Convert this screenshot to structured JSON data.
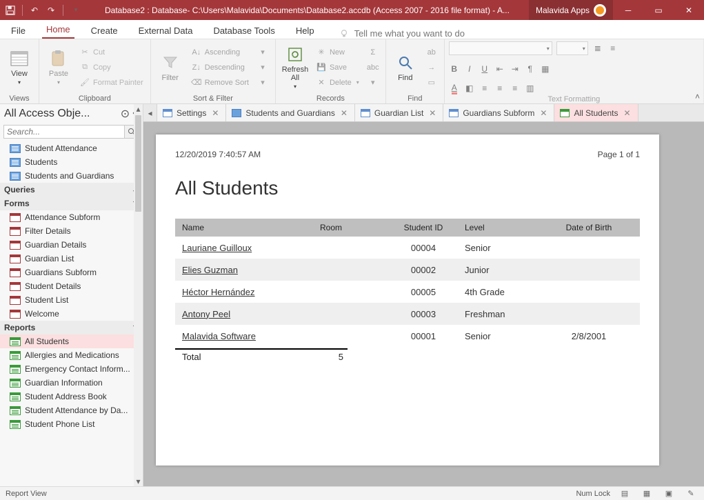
{
  "titlebar": {
    "title": "Database2 : Database- C:\\Users\\Malavida\\Documents\\Database2.accdb (Access 2007 - 2016 file format) -  A...",
    "app_button": "Malavida Apps"
  },
  "tabs": {
    "file": "File",
    "home": "Home",
    "create": "Create",
    "external": "External Data",
    "dbtools": "Database Tools",
    "help": "Help",
    "tell_placeholder": "Tell me what you want to do"
  },
  "ribbon": {
    "views": {
      "label": "Views",
      "view": "View"
    },
    "clipboard": {
      "label": "Clipboard",
      "paste": "Paste",
      "cut": "Cut",
      "copy": "Copy",
      "format": "Format Painter"
    },
    "sortfilter": {
      "label": "Sort & Filter",
      "filter": "Filter",
      "asc": "Ascending",
      "desc": "Descending",
      "remove": "Remove Sort"
    },
    "records": {
      "label": "Records",
      "refresh": "Refresh All",
      "new": "New",
      "save": "Save",
      "delete": "Delete"
    },
    "find": {
      "label": "Find",
      "find": "Find"
    },
    "textfmt": {
      "label": "Text Formatting"
    }
  },
  "nav": {
    "header": "All Access Obje...",
    "search_placeholder": "Search...",
    "cat_queries": "Queries",
    "cat_forms": "Forms",
    "cat_reports": "Reports",
    "tables": [
      "Student Attendance",
      "Students",
      "Students and Guardians"
    ],
    "forms": [
      "Attendance Subform",
      "Filter Details",
      "Guardian Details",
      "Guardian List",
      "Guardians Subform",
      "Student Details",
      "Student List",
      "Welcome"
    ],
    "reports": [
      "All Students",
      "Allergies and Medications",
      "Emergency Contact Inform...",
      "Guardian Information",
      "Student Address Book",
      "Student Attendance by Da...",
      "Student Phone List"
    ]
  },
  "doctabs": [
    {
      "label": "Settings",
      "type": "frm"
    },
    {
      "label": "Students and Guardians",
      "type": "tbl"
    },
    {
      "label": "Guardian List",
      "type": "frm"
    },
    {
      "label": "Guardians Subform",
      "type": "frm"
    },
    {
      "label": "All Students",
      "type": "rpt"
    }
  ],
  "report": {
    "timestamp": "12/20/2019 7:40:57 AM",
    "pager": "Page 1 of 1",
    "title": "All Students",
    "cols": {
      "name": "Name",
      "room": "Room",
      "sid": "Student ID",
      "level": "Level",
      "dob": "Date of Birth"
    },
    "rows": [
      {
        "name": "Lauriane Guilloux",
        "room": "",
        "sid": "00004",
        "level": "Senior",
        "dob": ""
      },
      {
        "name": "Elies Guzman",
        "room": "",
        "sid": "00002",
        "level": "Junior",
        "dob": ""
      },
      {
        "name": "Héctor Hernández",
        "room": "",
        "sid": "00005",
        "level": "4th Grade",
        "dob": ""
      },
      {
        "name": "Antony Peel",
        "room": "",
        "sid": "00003",
        "level": "Freshman",
        "dob": ""
      },
      {
        "name": "Malavida Software",
        "room": "",
        "sid": "00001",
        "level": "Senior",
        "dob": "2/8/2001"
      }
    ],
    "total_label": "Total",
    "total_value": "5"
  },
  "status": {
    "left": "Report View",
    "numlock": "Num Lock"
  }
}
